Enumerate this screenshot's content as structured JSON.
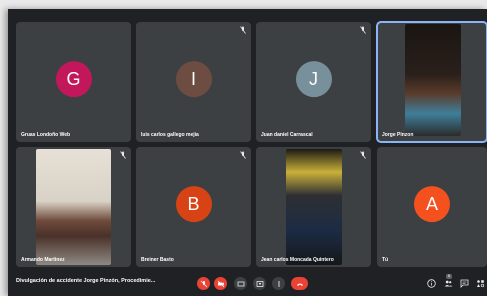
{
  "participants": [
    {
      "name": "Gruas Londoño Web",
      "initial": "G",
      "color": "#c2185b",
      "muted": false
    },
    {
      "name": "luis carlos gallego mejia",
      "initial": "I",
      "color": "#6d4c41",
      "muted": true
    },
    {
      "name": "Juan daniel Carrascal",
      "initial": "J",
      "color": "#78909c",
      "muted": true
    },
    {
      "name": "Jorge Pinzon",
      "initial": "",
      "color": "",
      "muted": false
    },
    {
      "name": "Armando Martinez",
      "initial": "",
      "color": "",
      "muted": true
    },
    {
      "name": "Breiner Basto",
      "initial": "B",
      "color": "#d84315",
      "muted": true
    },
    {
      "name": "Jean carlos Moncada Quintero",
      "initial": "",
      "color": "",
      "muted": true
    },
    {
      "name": "Tú",
      "initial": "A",
      "color": "#f4511e",
      "muted": false
    }
  ],
  "bottom_bar": {
    "meeting_title": "Divulgación de accidente Jorge Pinzón, Procedimie...",
    "people_count": "8",
    "controls": [
      "mic-off-icon",
      "camera-off-icon",
      "captions-icon",
      "present-icon",
      "more-icon",
      "hangup-icon"
    ],
    "right_icons": [
      "info-icon",
      "people-icon",
      "chat-icon",
      "activities-icon"
    ]
  }
}
